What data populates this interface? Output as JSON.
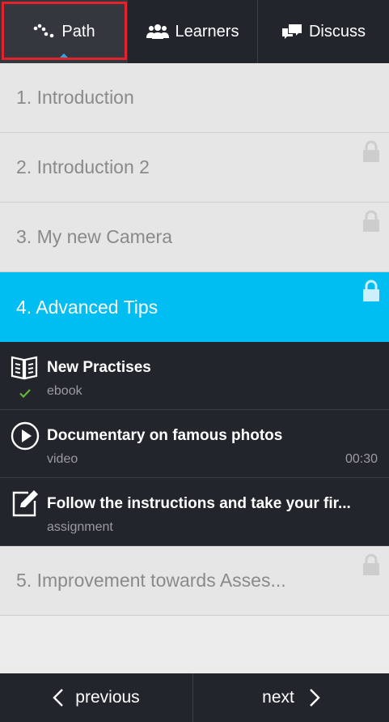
{
  "tabs": {
    "path": {
      "label": "Path",
      "icon": "path-icon"
    },
    "learners": {
      "label": "Learners",
      "icon": "learners-icon"
    },
    "discuss": {
      "label": "Discuss",
      "icon": "discuss-icon"
    }
  },
  "modules": [
    {
      "title": "1. Introduction",
      "locked": false,
      "active": false
    },
    {
      "title": "2. Introduction 2",
      "locked": true,
      "active": false
    },
    {
      "title": "3. My new Camera",
      "locked": true,
      "active": false
    },
    {
      "title": "4. Advanced Tips",
      "locked": true,
      "active": true
    },
    {
      "title": "5. Improvement towards Asses...",
      "locked": true,
      "active": false
    }
  ],
  "lessons": [
    {
      "title": "New Practises",
      "type": "ebook",
      "icon": "ebook-icon",
      "completed": true
    },
    {
      "title": "Documentary on famous photos",
      "type": "video",
      "duration": "00:30",
      "icon": "play-icon"
    },
    {
      "title": "Follow the instructions and take your fir...",
      "type": "assignment",
      "icon": "assignment-icon"
    }
  ],
  "nav": {
    "previous_label": "previous",
    "next_label": "next"
  },
  "colors": {
    "active_module": "#00bdf2",
    "dark_bg": "#22252b",
    "highlight_border": "#e3232b",
    "check": "#6ab23c"
  }
}
